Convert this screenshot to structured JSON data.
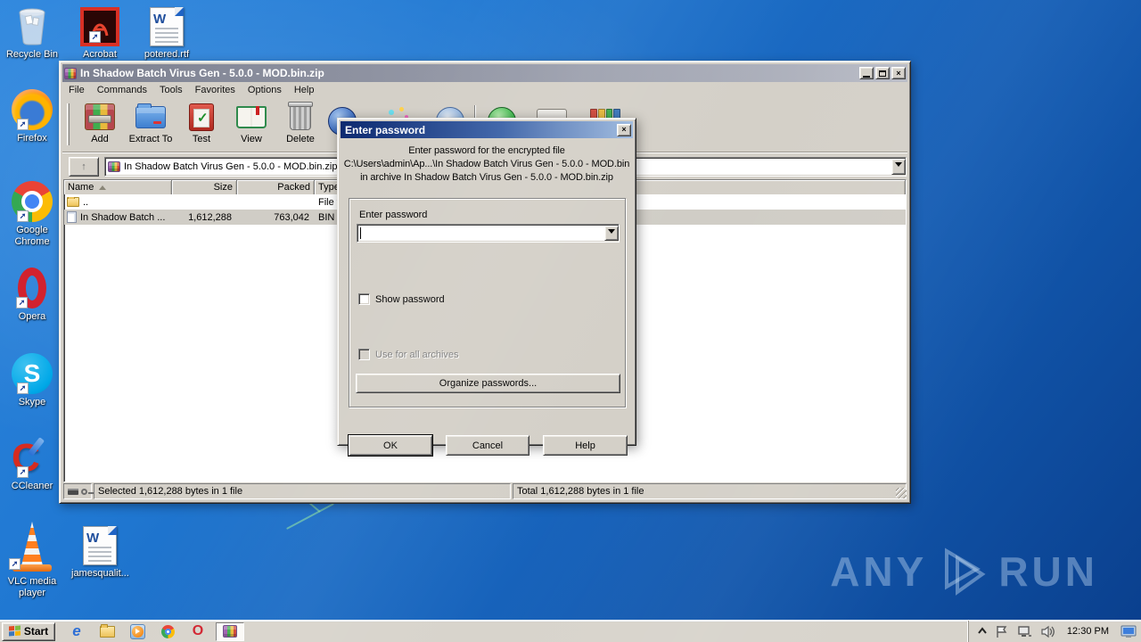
{
  "colors": {
    "desktop_blue": "#1e6fcb",
    "chrome_gray": "#d4d0c8",
    "dialog_titlebar_start": "#0d2a70",
    "dialog_titlebar_end": "#9fbbdf",
    "inactive_titlebar_start": "#7c8090",
    "inactive_titlebar_end": "#b9bcc6",
    "selection_inactive": "#d0cdc6"
  },
  "desktop": {
    "icons": [
      {
        "label": "Recycle Bin"
      },
      {
        "label": "Acrobat"
      },
      {
        "label": "potered.rtf"
      },
      {
        "label": "Firefox"
      },
      {
        "label": "Google Chrome"
      },
      {
        "label": "Opera"
      },
      {
        "label": "Skype"
      },
      {
        "label": "CCleaner"
      },
      {
        "label": "VLC media player"
      },
      {
        "label": "jamesqualit..."
      }
    ],
    "watermark_left": "ANY",
    "watermark_right": "RUN"
  },
  "winrar": {
    "title": "In Shadow Batch Virus Gen - 5.0.0 - MOD.bin.zip",
    "menu": [
      "File",
      "Commands",
      "Tools",
      "Favorites",
      "Options",
      "Help"
    ],
    "toolbar": [
      "Add",
      "Extract To",
      "Test",
      "View",
      "Delete"
    ],
    "address": "In Shadow Batch Virus Gen - 5.0.0 - MOD.bin.zip",
    "columns": [
      "Name",
      "Size",
      "Packed",
      "Type"
    ],
    "rows": [
      {
        "name": "..",
        "size": "",
        "packed": "",
        "type": "File folder"
      },
      {
        "name": "In Shadow Batch ...",
        "size": "1,612,288",
        "packed": "763,042",
        "type": "BIN"
      }
    ],
    "status_selected": "Selected 1,612,288 bytes in 1 file",
    "status_total": "Total 1,612,288 bytes in 1 file"
  },
  "dialog": {
    "title": "Enter password",
    "prompt_line1": "Enter password for the encrypted file",
    "prompt_line2": "C:\\Users\\admin\\Ap...\\In Shadow Batch Virus Gen - 5.0.0 - MOD.bin",
    "prompt_line3": "in archive In Shadow Batch Virus Gen - 5.0.0 - MOD.bin.zip",
    "group_label": "Enter password",
    "show_password_label": "Show password",
    "use_for_all_label": "Use for all archives",
    "organize_button": "Organize passwords...",
    "ok_button": "OK",
    "cancel_button": "Cancel",
    "help_button": "Help"
  },
  "taskbar": {
    "start_label": "Start",
    "clock": "12:30 PM"
  }
}
